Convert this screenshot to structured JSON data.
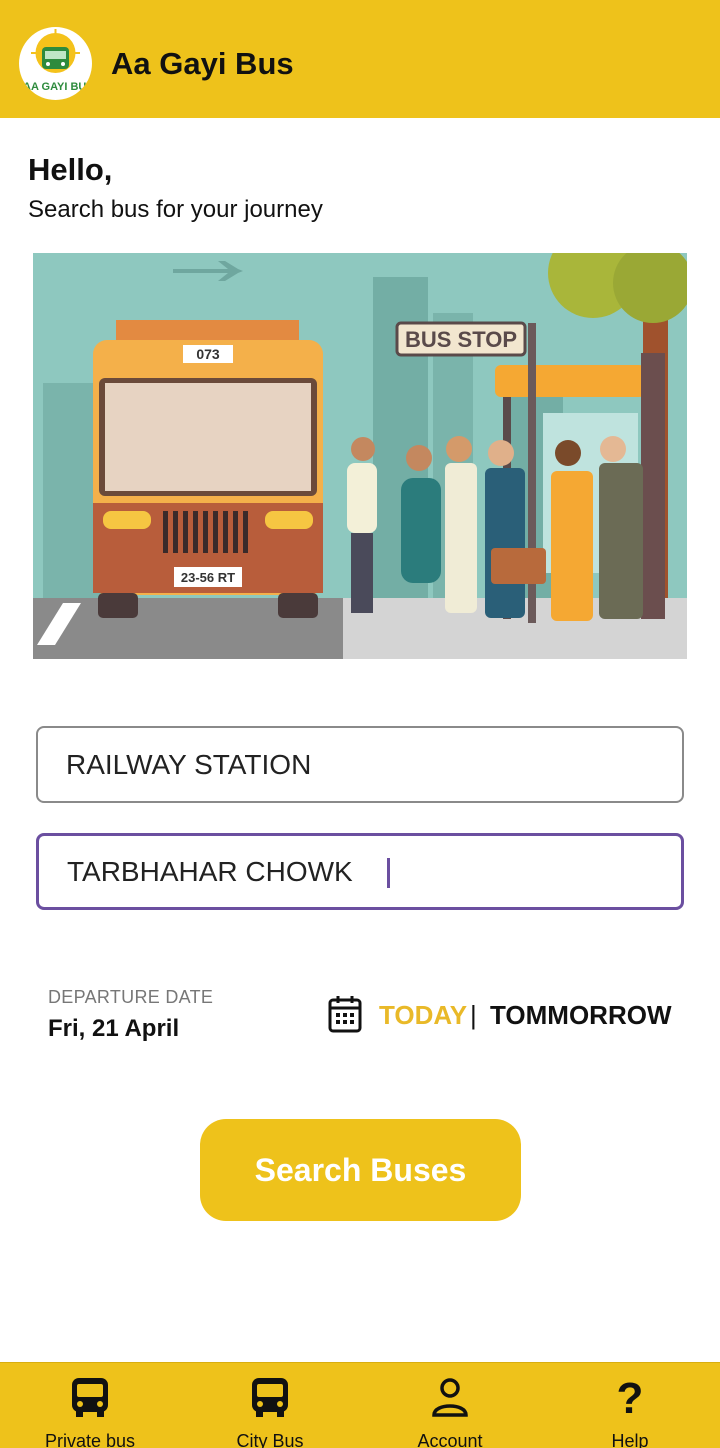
{
  "app": {
    "title": "Aa Gayi Bus",
    "logo_text": "AA GAYI BUS",
    "accent_color": "#eec21b"
  },
  "greeting": {
    "hello": "Hello,",
    "subtitle": "Search bus for your journey"
  },
  "hero": {
    "bus_number": "073",
    "plate": "23-56 RT",
    "stop_sign": "BUS STOP"
  },
  "search": {
    "from_value": "RAILWAY STATION",
    "to_value": "TARBHAHAR CHOWK"
  },
  "departure": {
    "label": "DEPARTURE DATE",
    "date": "Fri, 21 April",
    "today_label": "TODAY",
    "separator": "|",
    "tomorrow_label": "TOMMORROW",
    "calendar_icon": "calendar-icon"
  },
  "search_button": {
    "label": "Search Buses"
  },
  "bottom_nav": [
    {
      "label": "Private bus",
      "icon": "bus-icon"
    },
    {
      "label": "City Bus",
      "icon": "bus-icon"
    },
    {
      "label": "Account",
      "icon": "account-icon"
    },
    {
      "label": "Help",
      "icon": "help-icon"
    }
  ]
}
